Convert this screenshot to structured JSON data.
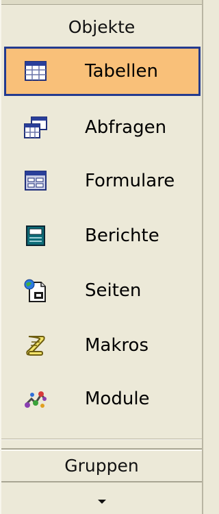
{
  "header": {
    "title": "Objekte"
  },
  "objects": {
    "items": [
      {
        "label": "Tabellen",
        "icon": "table-icon",
        "selected": true
      },
      {
        "label": "Abfragen",
        "icon": "query-icon",
        "selected": false
      },
      {
        "label": "Formulare",
        "icon": "form-icon",
        "selected": false
      },
      {
        "label": "Berichte",
        "icon": "report-icon",
        "selected": false
      },
      {
        "label": "Seiten",
        "icon": "page-icon",
        "selected": false
      },
      {
        "label": "Makros",
        "icon": "macro-icon",
        "selected": false
      },
      {
        "label": "Module",
        "icon": "module-icon",
        "selected": false
      }
    ]
  },
  "groups": {
    "title": "Gruppen"
  },
  "footer": {
    "scroll_icon": "chevron-down-icon"
  },
  "colors": {
    "selected_background": "#f9c079",
    "selected_border": "#233a8f",
    "panel_background": "#ece9d8"
  }
}
